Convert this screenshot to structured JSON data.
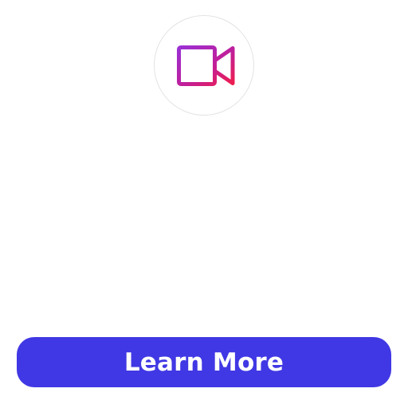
{
  "feature": {
    "icon": "video-camera-icon",
    "icon_gradient": [
      "#8b2fd6",
      "#e11d64"
    ]
  },
  "cta": {
    "label": "Learn More",
    "background": "#4038e4",
    "text_color": "#ffffff"
  }
}
